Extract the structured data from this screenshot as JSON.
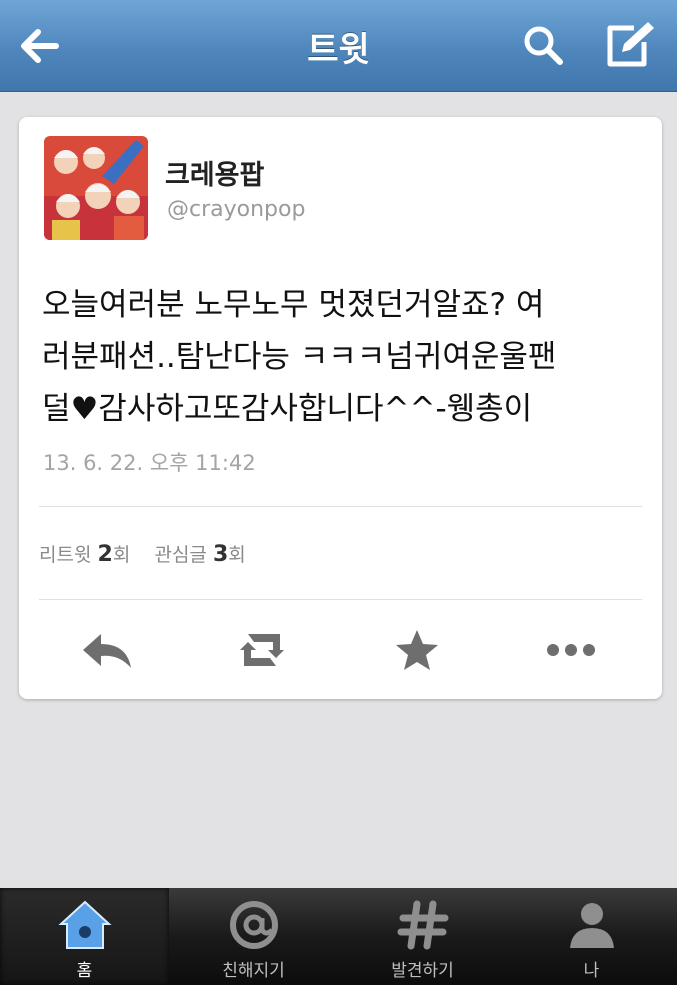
{
  "nav": {
    "title": "트윗",
    "back_icon": "back-arrow-icon",
    "search_icon": "search-icon",
    "compose_icon": "compose-icon"
  },
  "tweet": {
    "display_name": "크레용팝",
    "handle": "@crayonpop",
    "lines": [
      "오늘여러분 노무노무 멋졌던거알죠? 여",
      "러분패션..탐난다능 ㅋㅋㅋ넘귀여운울팬",
      "덜♥감사하고또감사합니다^^-웽총이"
    ],
    "timestamp": "13. 6. 22. 오후 11:42",
    "stats": {
      "retweet_label": "리트윗",
      "retweet_count": "2",
      "retweet_unit": "회",
      "favorite_label": "관심글",
      "favorite_count": "3",
      "favorite_unit": "회"
    },
    "actions": [
      "reply-icon",
      "retweet-icon",
      "favorite-star-icon",
      "more-dots-icon"
    ]
  },
  "tabbar": {
    "tabs": [
      {
        "label": "홈",
        "icon": "home-icon",
        "active": true
      },
      {
        "label": "친해지기",
        "icon": "at-icon",
        "active": false
      },
      {
        "label": "발견하기",
        "icon": "hash-icon",
        "active": false
      },
      {
        "label": "나",
        "icon": "profile-icon",
        "active": false
      }
    ]
  },
  "colors": {
    "navbar": "#4f87bd",
    "background": "#e2e2e4",
    "card": "#ffffff",
    "icon_gray": "#6e6e6e",
    "active_tab_icon": "#4a90d9"
  }
}
